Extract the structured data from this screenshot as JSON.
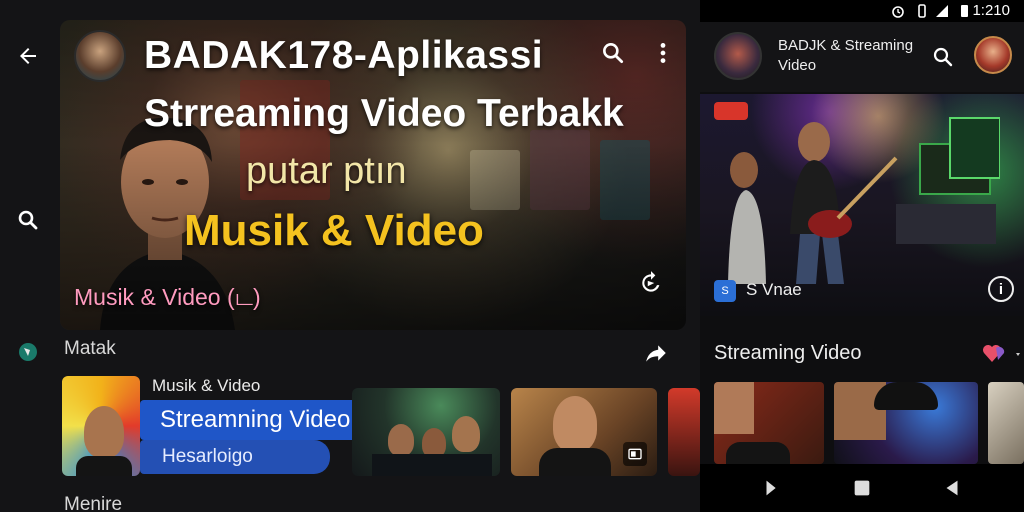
{
  "left": {
    "hero": {
      "title": "BADAK178-Aplikassi",
      "line2": "Strreaming Video Terbakk",
      "line3": "putar ptın",
      "line4": "Musik & Video",
      "caption": "Musik & Video (ட)"
    },
    "section1": {
      "label": "Matak"
    },
    "feature": {
      "top_label": "Musik & Video",
      "title": "Streamning Video",
      "subtitle": "Hesarloigo"
    },
    "section2": {
      "label": "Menire"
    }
  },
  "right": {
    "status": {
      "time": "1:210"
    },
    "appbar": {
      "title": "BADJK & Streaming Video"
    },
    "hero": {
      "label": "S Vnae",
      "badge_icon": "S"
    },
    "section": {
      "label": "Streaming Video"
    }
  },
  "colors": {
    "accent_blue": "#1f56c8",
    "yellow": "#f4c21f",
    "pink": "#ff9bbf"
  },
  "icons": [
    "back-arrow-icon",
    "search-icon",
    "more-vert-icon",
    "share-icon",
    "rotate-icon",
    "info-icon",
    "nav-back-icon",
    "nav-home-icon",
    "nav-recent-icon"
  ]
}
